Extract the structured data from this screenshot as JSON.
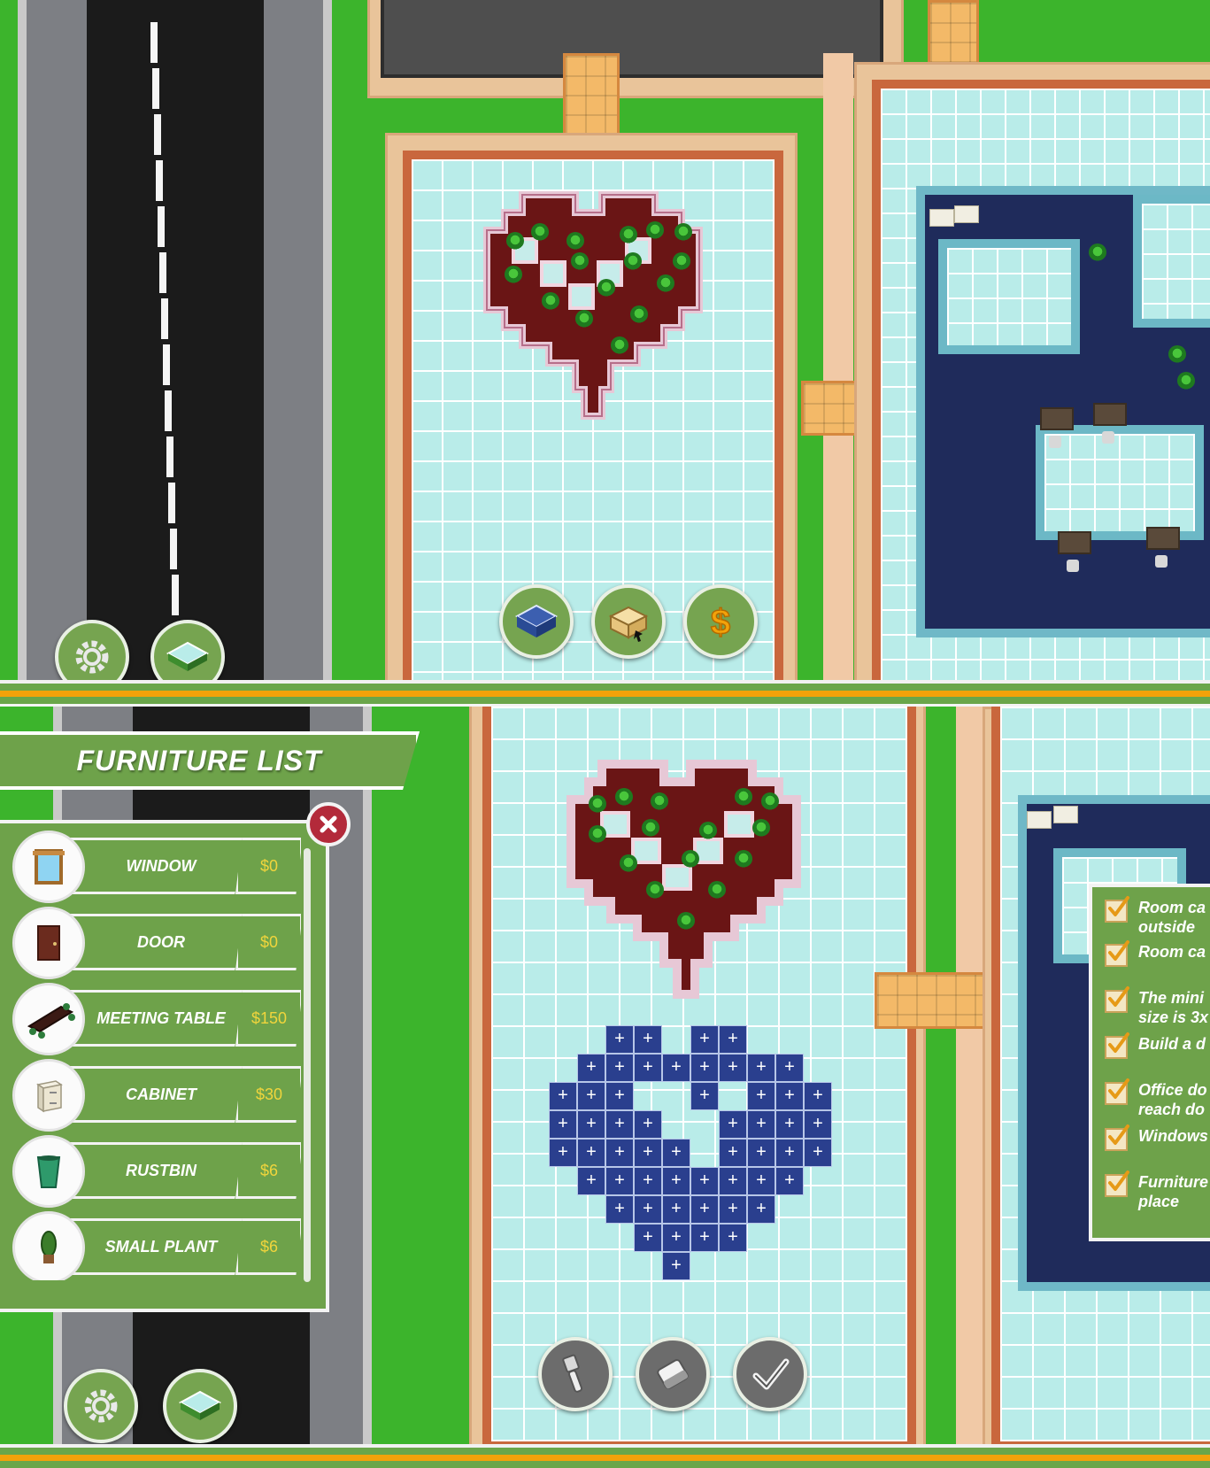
{
  "colors": {
    "grass": "#3cb42c",
    "ui_green": "#6ea24a",
    "price_yellow": "#f0d53c",
    "close_red": "#b32a3a",
    "accent_orange": "#f3a20a"
  },
  "top_view": {
    "hud_buttons": [
      {
        "icon": "gear-icon"
      },
      {
        "icon": "floor-tile-icon"
      }
    ],
    "build_buttons": [
      {
        "icon": "room-build-icon"
      },
      {
        "icon": "furniture-box-icon"
      },
      {
        "icon": "dollar-icon"
      }
    ]
  },
  "furniture_list": {
    "title": "FURNITURE LIST",
    "close_icon": "close-icon",
    "items": [
      {
        "name": "WINDOW",
        "price": "$0",
        "icon": "window-icon"
      },
      {
        "name": "DOOR",
        "price": "$0",
        "icon": "door-icon"
      },
      {
        "name": "MEETING TABLE",
        "price": "$150",
        "icon": "meeting-table-icon"
      },
      {
        "name": "CABINET",
        "price": "$30",
        "icon": "cabinet-icon"
      },
      {
        "name": "RUSTBIN",
        "price": "$6",
        "icon": "rustbin-icon"
      },
      {
        "name": "SMALL PLANT",
        "price": "$6",
        "icon": "small-plant-icon"
      }
    ]
  },
  "checklist": {
    "items": [
      {
        "text": "Room ca\noutside",
        "checked": true
      },
      {
        "text": "Room ca",
        "checked": true
      },
      {
        "text": "The mini\nsize is 3x",
        "checked": true
      },
      {
        "text": "Build a d",
        "checked": true
      },
      {
        "text": "Office do\nreach do",
        "checked": true
      },
      {
        "text": "Windows",
        "checked": true
      },
      {
        "text": "Furniture\nplace",
        "checked": true
      }
    ]
  },
  "bottom_view": {
    "hud_buttons": [
      {
        "icon": "gear-icon"
      },
      {
        "icon": "floor-tile-icon"
      }
    ],
    "edit_buttons": [
      {
        "icon": "paint-brush-icon"
      },
      {
        "icon": "eraser-icon"
      },
      {
        "icon": "confirm-check-icon"
      }
    ]
  }
}
